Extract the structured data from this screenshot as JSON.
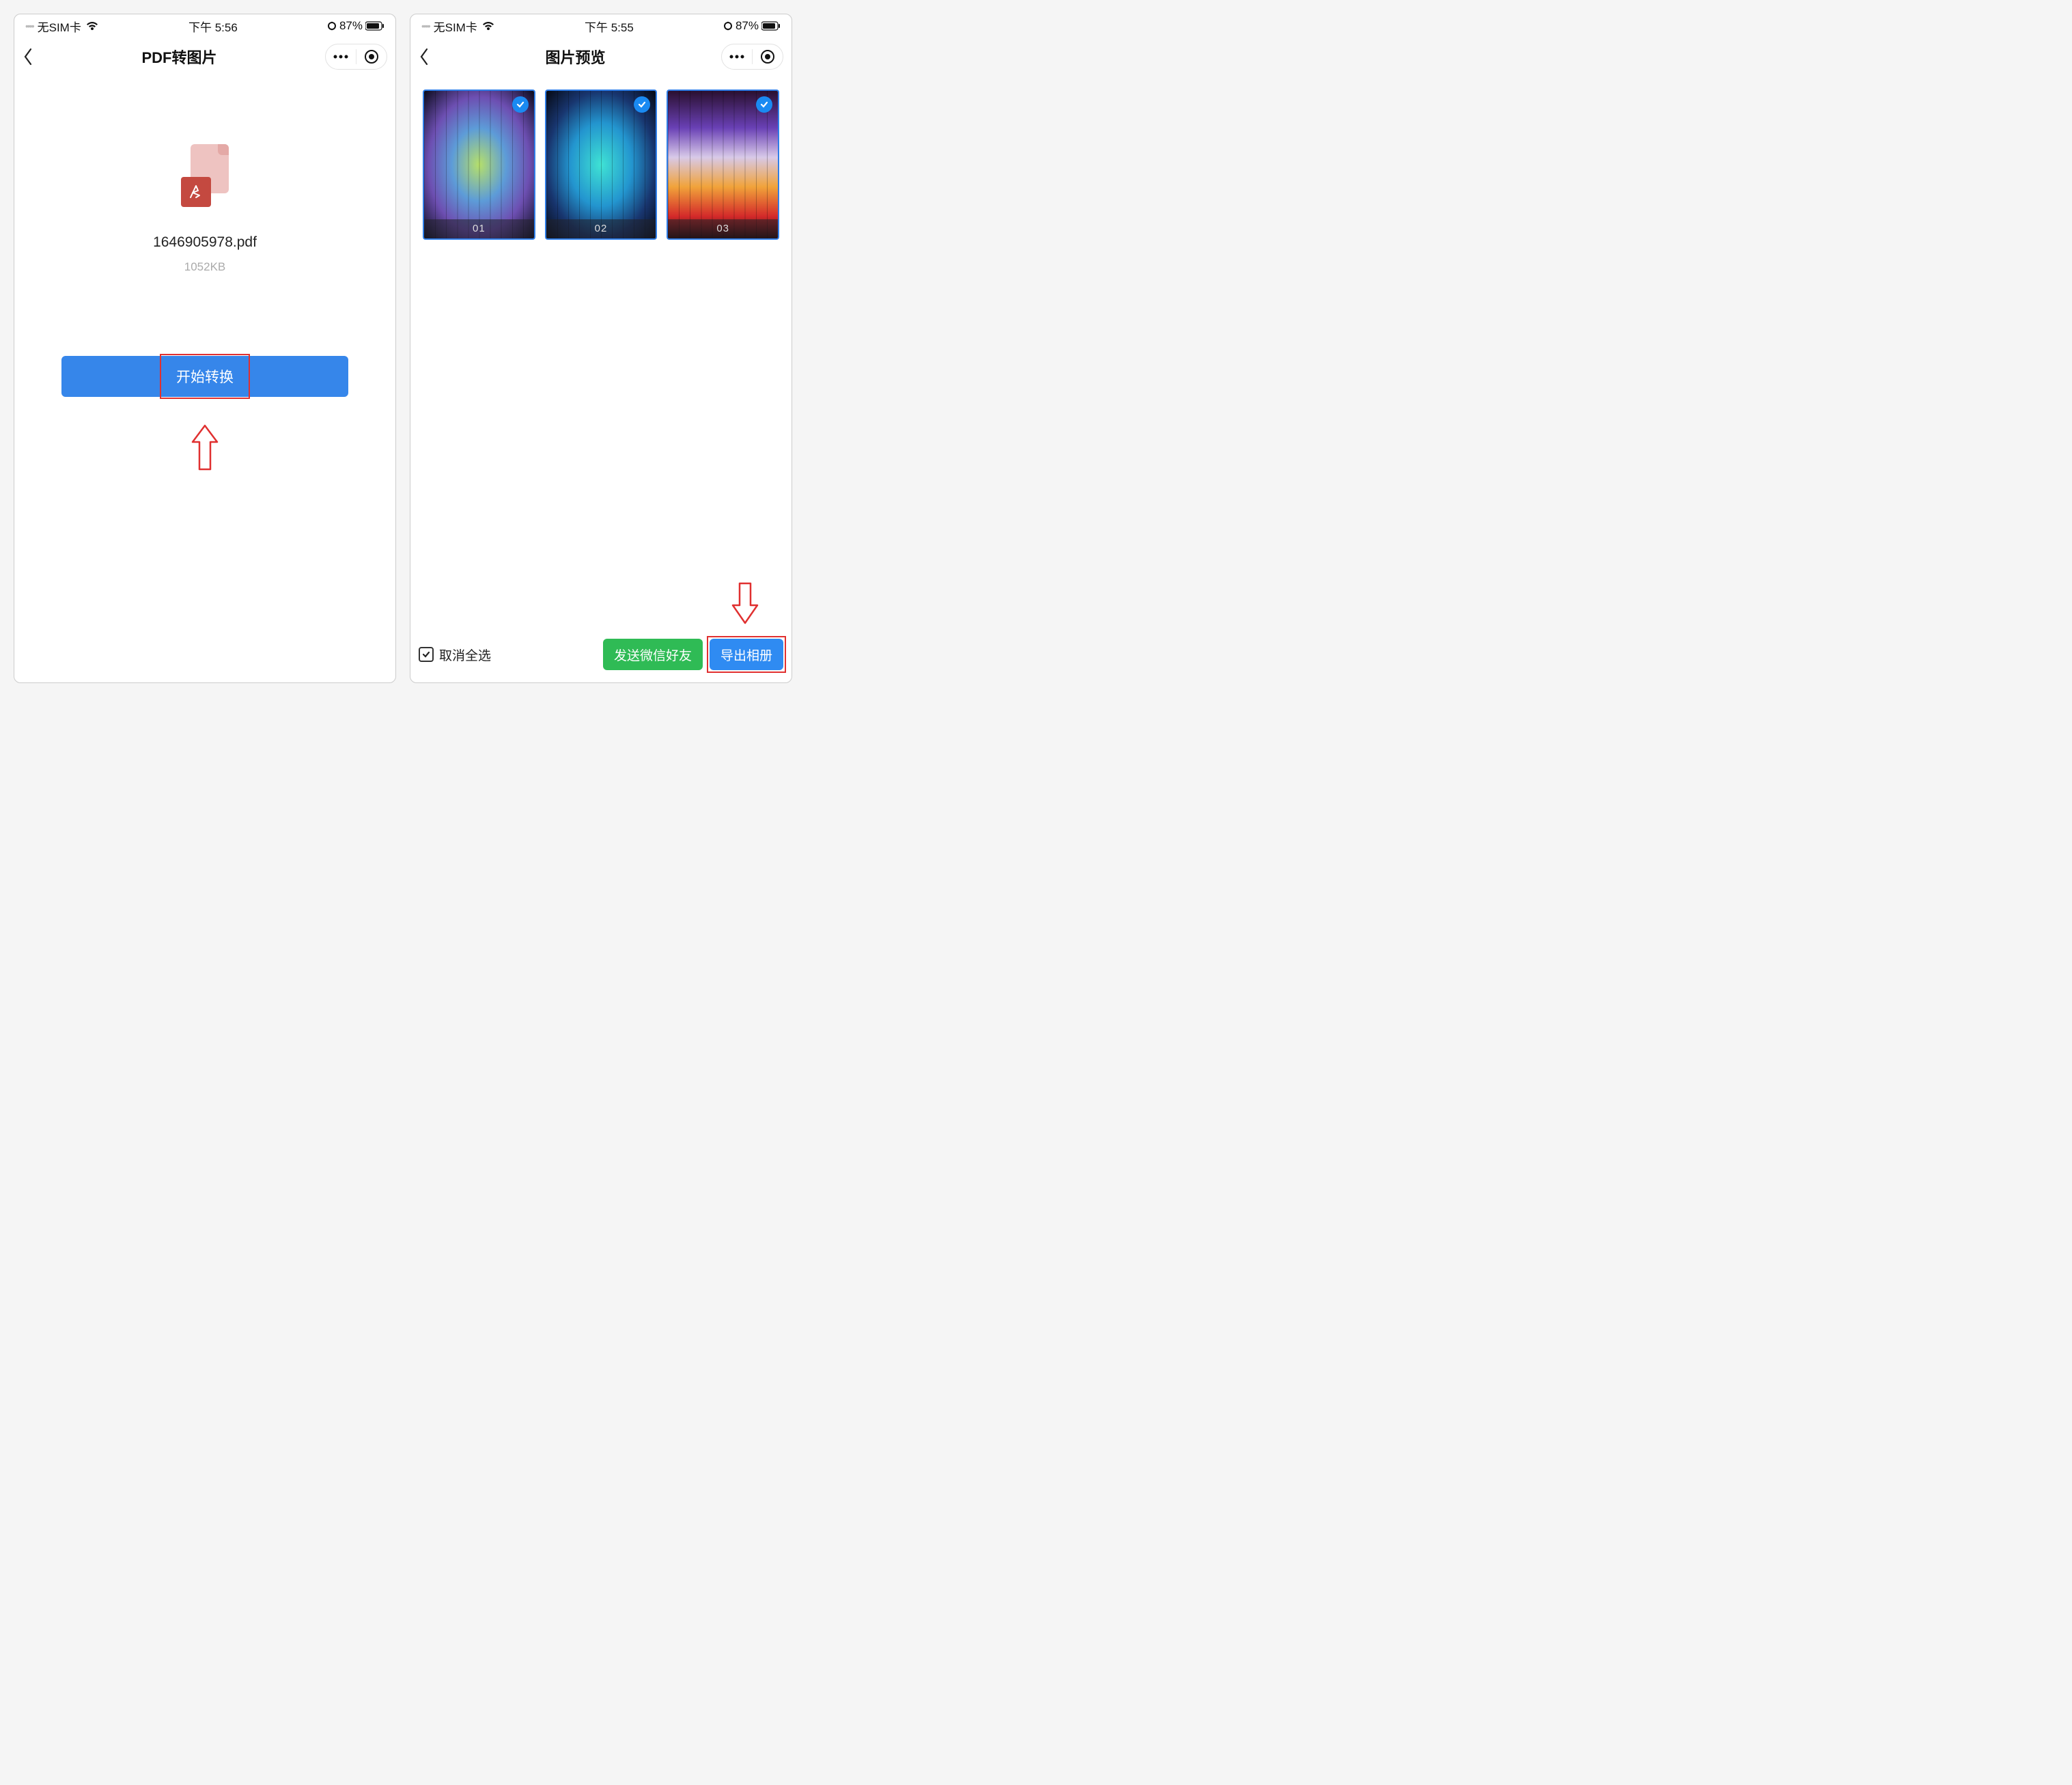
{
  "screen1": {
    "status": {
      "carrier": "无SIM卡",
      "time": "下午 5:56",
      "battery": "87%"
    },
    "title": "PDF转图片",
    "filename": "1646905978.pdf",
    "filesize": "1052KB",
    "convert_button": "开始转换"
  },
  "screen2": {
    "status": {
      "carrier": "无SIM卡",
      "time": "下午 5:55",
      "battery": "87%"
    },
    "title": "图片预览",
    "thumbnails": [
      {
        "label": "01",
        "selected": true
      },
      {
        "label": "02",
        "selected": true
      },
      {
        "label": "03",
        "selected": true
      }
    ],
    "deselect_all": "取消全选",
    "send_wechat": "发送微信好友",
    "export_album": "导出相册"
  }
}
